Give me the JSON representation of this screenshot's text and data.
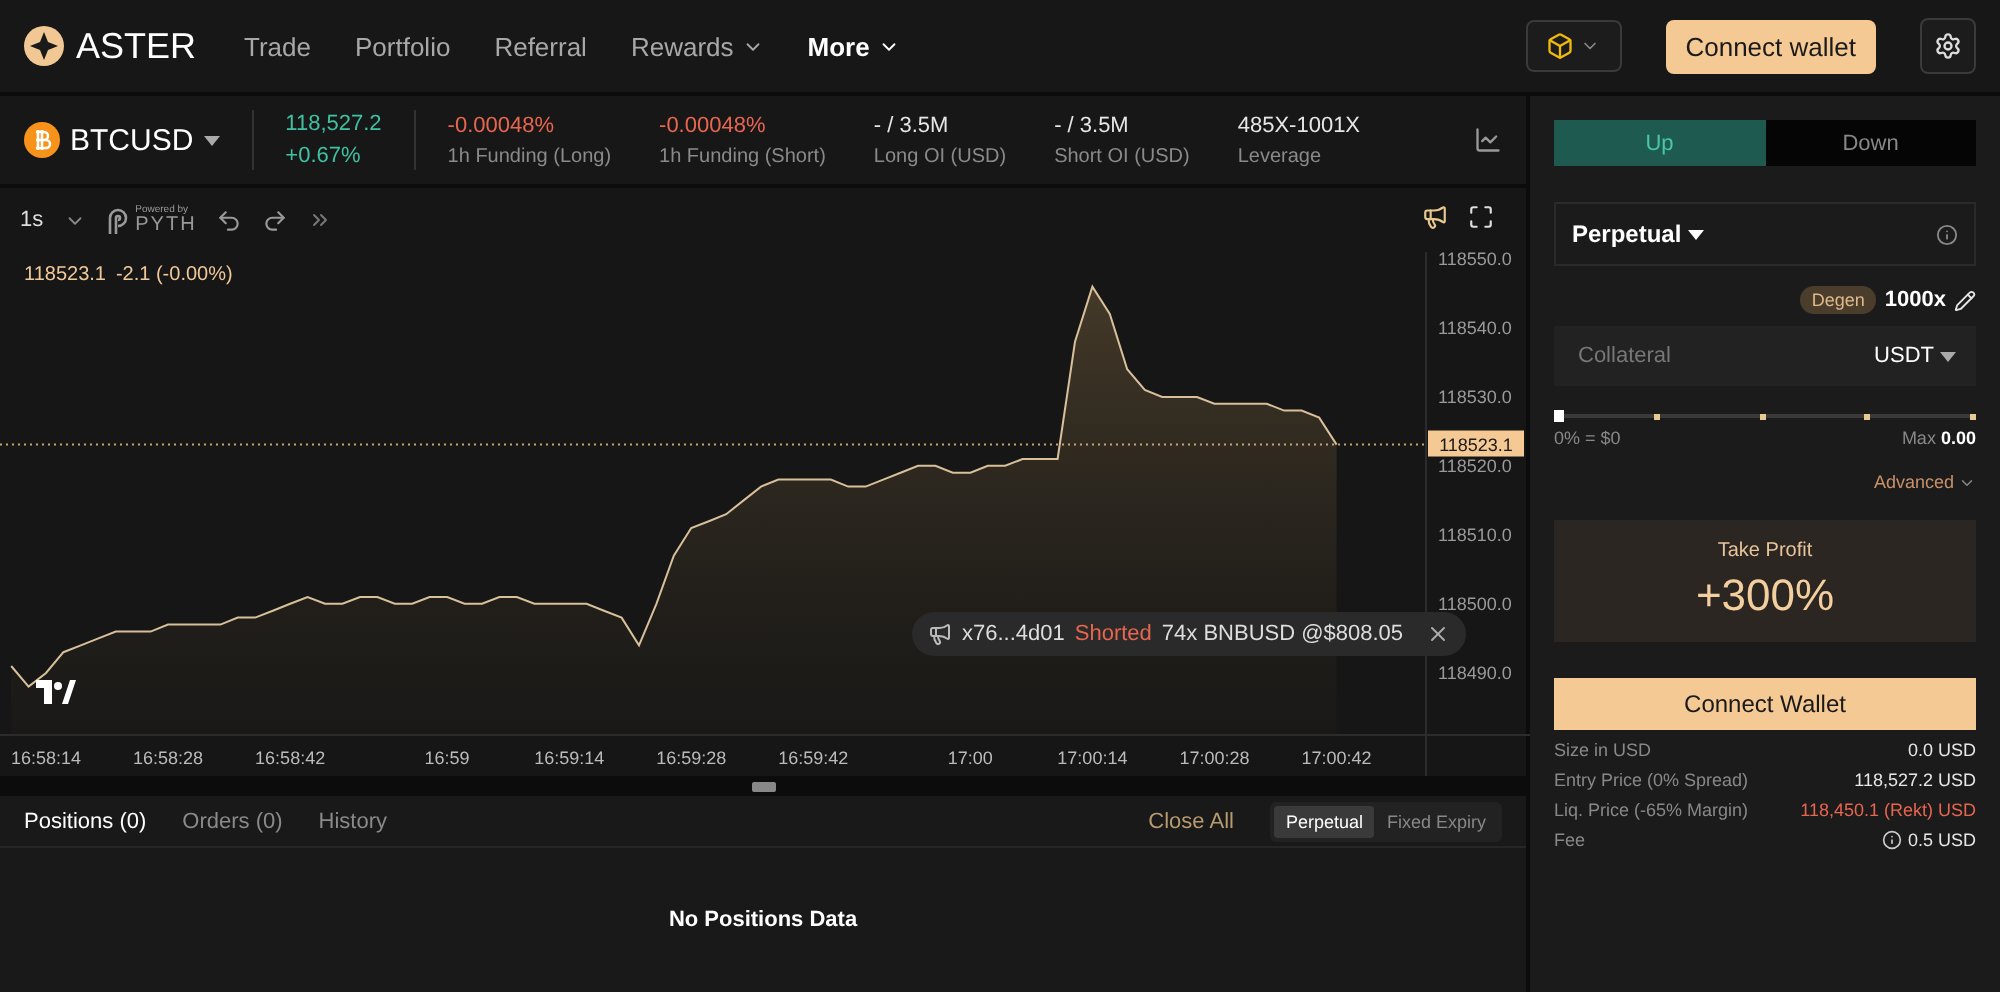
{
  "header": {
    "logo": "ASTER",
    "nav": [
      {
        "label": "Trade",
        "selected": false,
        "has_menu": false
      },
      {
        "label": "Portfolio",
        "selected": false,
        "has_menu": false
      },
      {
        "label": "Referral",
        "selected": false,
        "has_menu": false
      },
      {
        "label": "Rewards",
        "selected": false,
        "has_menu": true
      },
      {
        "label": "More",
        "selected": true,
        "has_menu": true
      }
    ],
    "connect_button": "Connect wallet"
  },
  "ticker": {
    "symbol": "BTCUSD",
    "price": "118,527.2",
    "change": "+0.67%",
    "stats": [
      {
        "value": "-0.00048%",
        "label": "1h Funding (Long)",
        "color": "#e8654f"
      },
      {
        "value": "-0.00048%",
        "label": "1h Funding (Short)",
        "color": "#e8654f"
      },
      {
        "value": "- / 3.5M",
        "label": "Long OI (USD)",
        "color": "#e6e6e6"
      },
      {
        "value": "- / 3.5M",
        "label": "Short OI (USD)",
        "color": "#e6e6e6"
      },
      {
        "value": "485X-1001X",
        "label": "Leverage",
        "color": "#e6e6e6"
      }
    ]
  },
  "chart_toolbar": {
    "interval": "1s",
    "pyth_caption": "Powered by",
    "pyth_name": "PYTH"
  },
  "chart": {
    "legend": {
      "price": "118523.1",
      "change": "-2.1 (-0.00%)"
    },
    "last_price": "118523.1",
    "toast": {
      "address": "x76...4d01",
      "action": "Shorted",
      "details": "74x BNBUSD @$808.05"
    },
    "chart_data": {
      "type": "area",
      "categories": [
        null,
        null,
        "16:58:14",
        null,
        null,
        null,
        null,
        null,
        null,
        "16:58:28",
        null,
        null,
        null,
        null,
        null,
        null,
        "16:58:42",
        null,
        null,
        null,
        null,
        null,
        null,
        null,
        null,
        "16:59",
        null,
        null,
        null,
        null,
        null,
        null,
        "16:59:14",
        null,
        null,
        null,
        null,
        null,
        null,
        "16:59:28",
        null,
        null,
        null,
        null,
        null,
        null,
        "16:59:42",
        null,
        null,
        null,
        null,
        null,
        null,
        null,
        null,
        "17:00",
        null,
        null,
        null,
        null,
        null,
        null,
        "17:00:14",
        null,
        null,
        null,
        null,
        null,
        null,
        "17:00:28",
        null,
        null,
        null,
        null,
        null,
        null,
        "17:00:42"
      ],
      "values": [
        118491,
        118488,
        118490,
        118493,
        118494,
        118495,
        118496,
        118496,
        118496,
        118497,
        118497,
        118497,
        118497,
        118498,
        118498,
        118499,
        118500,
        118501,
        118500,
        118500,
        118501,
        118501,
        118500,
        118500,
        118501,
        118501,
        118500,
        118500,
        118501,
        118501,
        118500,
        118500,
        118500,
        118500,
        118499,
        118498,
        118494,
        118500,
        118507,
        118511,
        118512,
        118513,
        118515,
        118517,
        118518,
        118518,
        118518,
        118518,
        118517,
        118517,
        118518,
        118519,
        118520,
        118520,
        118519,
        118519,
        118520,
        118520,
        118521,
        118521,
        118521,
        118538,
        118546,
        118542,
        118534,
        118531,
        118530,
        118530,
        118530,
        118529,
        118529,
        118529,
        118529,
        118528,
        118528,
        118527,
        118523.1
      ],
      "yticks": [
        {
          "value": 118490,
          "label": "118490.0"
        },
        {
          "value": 118500,
          "label": "118500.0"
        },
        {
          "value": 118510,
          "label": "118510.0"
        },
        {
          "value": 118520,
          "label": "118520.0"
        },
        {
          "value": 118530,
          "label": "118530.0"
        },
        {
          "value": 118540,
          "label": "118540.0"
        },
        {
          "value": 118550,
          "label": "118550.0"
        }
      ],
      "ylim": [
        118481,
        118551
      ],
      "ref_lines": [
        {
          "axis": "y",
          "value": 118523.1
        }
      ]
    }
  },
  "positions": {
    "tabs": [
      {
        "label": "Positions (0)",
        "selected": true
      },
      {
        "label": "Orders (0)",
        "selected": false
      },
      {
        "label": "History",
        "selected": false
      }
    ],
    "close_all": "Close All",
    "segments": [
      {
        "label": "Perpetual",
        "selected": true
      },
      {
        "label": "Fixed Expiry",
        "selected": false
      }
    ],
    "empty": "No Positions Data"
  },
  "order": {
    "sides": [
      {
        "label": "Up",
        "selected": true
      },
      {
        "label": "Down",
        "selected": false
      }
    ],
    "market": "Perpetual",
    "degen": "Degen",
    "leverage": "1000x",
    "collateral_placeholder": "Collateral",
    "currency": "USDT",
    "slider": {
      "level": 0,
      "min_label": "0% = $0",
      "max_label": "Max",
      "max_value": "0.00"
    },
    "advanced": "Advanced",
    "take_profit": {
      "label": "Take Profit",
      "value": "+300%"
    },
    "connect_button": "Connect Wallet",
    "summary": [
      {
        "label": "Size in USD",
        "value": "0.0 USD",
        "color": "#e6e6e6",
        "info": false
      },
      {
        "label": "Entry Price (0% Spread)",
        "value": "118,527.2 USD",
        "color": "#e6e6e6",
        "info": false
      },
      {
        "label": "Liq. Price (-65% Margin)",
        "value": "118,450.1 (Rekt) USD",
        "color": "#e8654f",
        "info": false
      },
      {
        "label": "Fee",
        "value": "0.5 USD",
        "color": "#e6e6e6",
        "info": true
      }
    ]
  }
}
